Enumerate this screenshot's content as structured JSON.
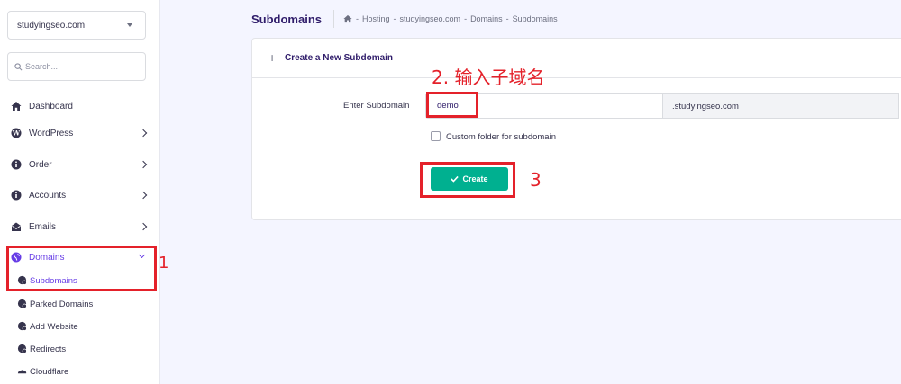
{
  "sidebar": {
    "domain_select": "studyingseo.com",
    "search_placeholder": "Search...",
    "items": [
      {
        "label": "Dashboard"
      },
      {
        "label": "WordPress"
      },
      {
        "label": "Order"
      },
      {
        "label": "Accounts"
      },
      {
        "label": "Emails"
      },
      {
        "label": "Domains"
      }
    ],
    "sub_items": [
      {
        "label": "Subdomains"
      },
      {
        "label": "Parked Domains"
      },
      {
        "label": "Add Website"
      },
      {
        "label": "Redirects"
      },
      {
        "label": "Cloudflare"
      }
    ]
  },
  "header": {
    "title": "Subdomains",
    "breadcrumb": [
      "Hosting",
      "studyingseo.com",
      "Domains",
      "Subdomains"
    ],
    "breadcrumb_sep": "-"
  },
  "card": {
    "title": "Create a New Subdomain",
    "field_label": "Enter Subdomain",
    "input_value": "demo",
    "suffix": ".studyingseo.com",
    "checkbox_label": "Custom folder for subdomain",
    "create_label": "Create"
  },
  "annotations": {
    "step1": "1",
    "step2": "2. 输入子域名",
    "step3": "3"
  },
  "colors": {
    "accent": "#673de6",
    "create_button": "#00b090",
    "annotation": "#e4212a"
  }
}
